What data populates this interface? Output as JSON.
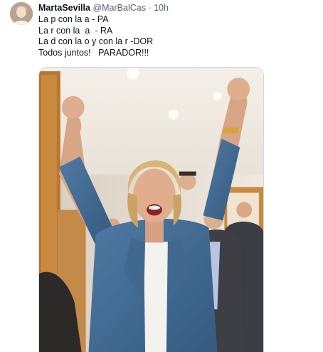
{
  "tweet": {
    "author": {
      "display_name": "MartaSevilla",
      "handle": "@MarBalCas",
      "separator": "·",
      "time": "10h",
      "avatar_icon": "user-avatar"
    },
    "text_lines": [
      "La p con la a - PA",
      "La r con la  a  - RA",
      "La d con la o y con la r -DOR",
      "Todos juntos!   PARADOR!!!"
    ],
    "media": {
      "kind": "photo"
    }
  },
  "colors": {
    "primary_text": "#0f1419",
    "secondary_text": "#536471",
    "border": "#cfd9de"
  }
}
